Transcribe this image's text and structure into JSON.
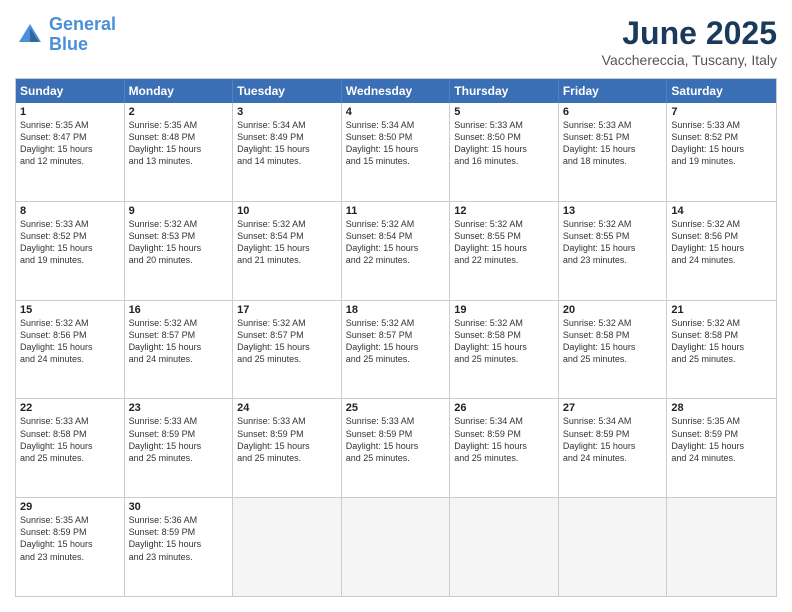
{
  "logo": {
    "line1": "General",
    "line2": "Blue"
  },
  "title": "June 2025",
  "location": "Vacchereccia, Tuscany, Italy",
  "header_days": [
    "Sunday",
    "Monday",
    "Tuesday",
    "Wednesday",
    "Thursday",
    "Friday",
    "Saturday"
  ],
  "rows": [
    [
      {
        "day": "1",
        "lines": [
          "Sunrise: 5:35 AM",
          "Sunset: 8:47 PM",
          "Daylight: 15 hours",
          "and 12 minutes."
        ]
      },
      {
        "day": "2",
        "lines": [
          "Sunrise: 5:35 AM",
          "Sunset: 8:48 PM",
          "Daylight: 15 hours",
          "and 13 minutes."
        ]
      },
      {
        "day": "3",
        "lines": [
          "Sunrise: 5:34 AM",
          "Sunset: 8:49 PM",
          "Daylight: 15 hours",
          "and 14 minutes."
        ]
      },
      {
        "day": "4",
        "lines": [
          "Sunrise: 5:34 AM",
          "Sunset: 8:50 PM",
          "Daylight: 15 hours",
          "and 15 minutes."
        ]
      },
      {
        "day": "5",
        "lines": [
          "Sunrise: 5:33 AM",
          "Sunset: 8:50 PM",
          "Daylight: 15 hours",
          "and 16 minutes."
        ]
      },
      {
        "day": "6",
        "lines": [
          "Sunrise: 5:33 AM",
          "Sunset: 8:51 PM",
          "Daylight: 15 hours",
          "and 18 minutes."
        ]
      },
      {
        "day": "7",
        "lines": [
          "Sunrise: 5:33 AM",
          "Sunset: 8:52 PM",
          "Daylight: 15 hours",
          "and 19 minutes."
        ]
      }
    ],
    [
      {
        "day": "8",
        "lines": [
          "Sunrise: 5:33 AM",
          "Sunset: 8:52 PM",
          "Daylight: 15 hours",
          "and 19 minutes."
        ]
      },
      {
        "day": "9",
        "lines": [
          "Sunrise: 5:32 AM",
          "Sunset: 8:53 PM",
          "Daylight: 15 hours",
          "and 20 minutes."
        ]
      },
      {
        "day": "10",
        "lines": [
          "Sunrise: 5:32 AM",
          "Sunset: 8:54 PM",
          "Daylight: 15 hours",
          "and 21 minutes."
        ]
      },
      {
        "day": "11",
        "lines": [
          "Sunrise: 5:32 AM",
          "Sunset: 8:54 PM",
          "Daylight: 15 hours",
          "and 22 minutes."
        ]
      },
      {
        "day": "12",
        "lines": [
          "Sunrise: 5:32 AM",
          "Sunset: 8:55 PM",
          "Daylight: 15 hours",
          "and 22 minutes."
        ]
      },
      {
        "day": "13",
        "lines": [
          "Sunrise: 5:32 AM",
          "Sunset: 8:55 PM",
          "Daylight: 15 hours",
          "and 23 minutes."
        ]
      },
      {
        "day": "14",
        "lines": [
          "Sunrise: 5:32 AM",
          "Sunset: 8:56 PM",
          "Daylight: 15 hours",
          "and 24 minutes."
        ]
      }
    ],
    [
      {
        "day": "15",
        "lines": [
          "Sunrise: 5:32 AM",
          "Sunset: 8:56 PM",
          "Daylight: 15 hours",
          "and 24 minutes."
        ]
      },
      {
        "day": "16",
        "lines": [
          "Sunrise: 5:32 AM",
          "Sunset: 8:57 PM",
          "Daylight: 15 hours",
          "and 24 minutes."
        ]
      },
      {
        "day": "17",
        "lines": [
          "Sunrise: 5:32 AM",
          "Sunset: 8:57 PM",
          "Daylight: 15 hours",
          "and 25 minutes."
        ]
      },
      {
        "day": "18",
        "lines": [
          "Sunrise: 5:32 AM",
          "Sunset: 8:57 PM",
          "Daylight: 15 hours",
          "and 25 minutes."
        ]
      },
      {
        "day": "19",
        "lines": [
          "Sunrise: 5:32 AM",
          "Sunset: 8:58 PM",
          "Daylight: 15 hours",
          "and 25 minutes."
        ]
      },
      {
        "day": "20",
        "lines": [
          "Sunrise: 5:32 AM",
          "Sunset: 8:58 PM",
          "Daylight: 15 hours",
          "and 25 minutes."
        ]
      },
      {
        "day": "21",
        "lines": [
          "Sunrise: 5:32 AM",
          "Sunset: 8:58 PM",
          "Daylight: 15 hours",
          "and 25 minutes."
        ]
      }
    ],
    [
      {
        "day": "22",
        "lines": [
          "Sunrise: 5:33 AM",
          "Sunset: 8:58 PM",
          "Daylight: 15 hours",
          "and 25 minutes."
        ]
      },
      {
        "day": "23",
        "lines": [
          "Sunrise: 5:33 AM",
          "Sunset: 8:59 PM",
          "Daylight: 15 hours",
          "and 25 minutes."
        ]
      },
      {
        "day": "24",
        "lines": [
          "Sunrise: 5:33 AM",
          "Sunset: 8:59 PM",
          "Daylight: 15 hours",
          "and 25 minutes."
        ]
      },
      {
        "day": "25",
        "lines": [
          "Sunrise: 5:33 AM",
          "Sunset: 8:59 PM",
          "Daylight: 15 hours",
          "and 25 minutes."
        ]
      },
      {
        "day": "26",
        "lines": [
          "Sunrise: 5:34 AM",
          "Sunset: 8:59 PM",
          "Daylight: 15 hours",
          "and 25 minutes."
        ]
      },
      {
        "day": "27",
        "lines": [
          "Sunrise: 5:34 AM",
          "Sunset: 8:59 PM",
          "Daylight: 15 hours",
          "and 24 minutes."
        ]
      },
      {
        "day": "28",
        "lines": [
          "Sunrise: 5:35 AM",
          "Sunset: 8:59 PM",
          "Daylight: 15 hours",
          "and 24 minutes."
        ]
      }
    ],
    [
      {
        "day": "29",
        "lines": [
          "Sunrise: 5:35 AM",
          "Sunset: 8:59 PM",
          "Daylight: 15 hours",
          "and 23 minutes."
        ]
      },
      {
        "day": "30",
        "lines": [
          "Sunrise: 5:36 AM",
          "Sunset: 8:59 PM",
          "Daylight: 15 hours",
          "and 23 minutes."
        ]
      },
      {
        "day": "",
        "lines": []
      },
      {
        "day": "",
        "lines": []
      },
      {
        "day": "",
        "lines": []
      },
      {
        "day": "",
        "lines": []
      },
      {
        "day": "",
        "lines": []
      }
    ]
  ]
}
